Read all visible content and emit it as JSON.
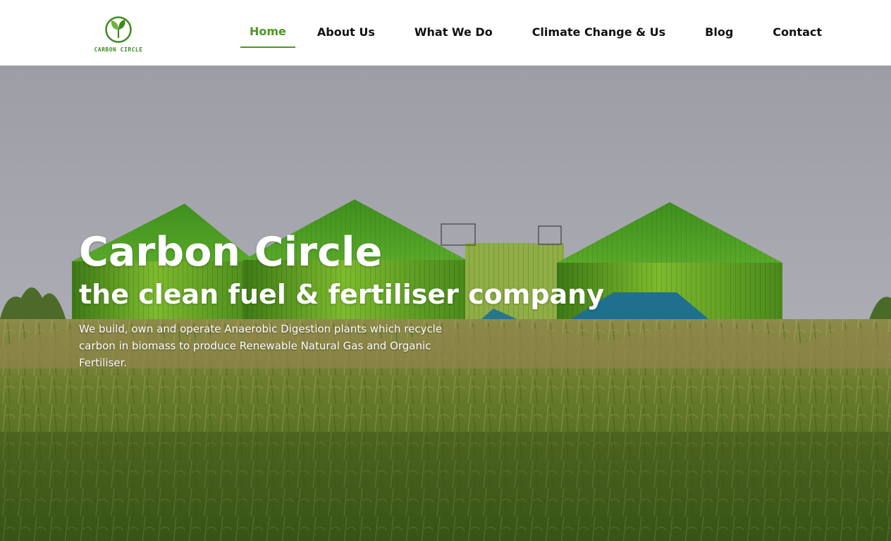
{
  "brand": {
    "logo_text": "CARBON CIRCLE",
    "icon": "leaf-circle-icon",
    "color": "#4a9a1f"
  },
  "nav": {
    "items": [
      {
        "label": "Home",
        "active": true
      },
      {
        "label": "About Us"
      },
      {
        "label": "What We Do"
      },
      {
        "label": "Climate Change & Us"
      },
      {
        "label": "Blog"
      },
      {
        "label": "Contact"
      }
    ],
    "active_color": "#4a9a1f"
  },
  "hero": {
    "title": "Carbon Circle",
    "subtitle": "the clean fuel & fertiliser company",
    "description": "We build, own and operate Anaerobic Digestion plants which recycle carbon in biomass to produce Renewable Natural Gas and Organic Fertiliser.",
    "background": "photo of green anaerobic digestion tanks behind a corn field"
  }
}
